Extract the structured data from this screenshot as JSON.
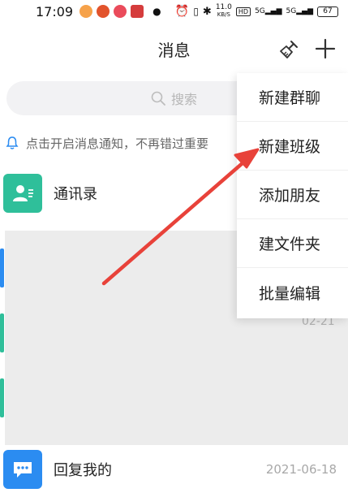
{
  "status_bar": {
    "time": "17:09",
    "network_speed": "11.0",
    "network_unit": "KB/S",
    "hd_badge": "HD",
    "signal_1": "5G",
    "signal_2": "5G",
    "battery": "67"
  },
  "header": {
    "title": "消息"
  },
  "search": {
    "placeholder": "搜索"
  },
  "notify": {
    "text": "点击开启消息通知，不再错过重要"
  },
  "rows": {
    "contacts_label": "通讯录",
    "peek_date": "02-21",
    "reply_label": "回复我的",
    "reply_date": "2021-06-18"
  },
  "menu": {
    "items": [
      {
        "label": "新建群聊"
      },
      {
        "label": "新建班级"
      },
      {
        "label": "添加朋友"
      },
      {
        "label": "新建文件夹",
        "visible": "建文件夹"
      },
      {
        "label": "批量编辑"
      }
    ]
  },
  "colors": {
    "accent_teal": "#2fbf9a",
    "accent_blue": "#2b8cf1",
    "arrow_red": "#e8423a"
  }
}
